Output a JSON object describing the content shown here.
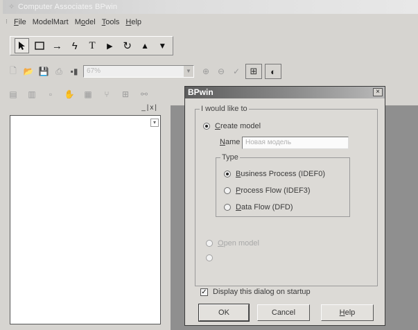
{
  "window": {
    "title": "Computer Associates BPwin"
  },
  "menubar": {
    "items": [
      {
        "pre": "",
        "u": "F",
        "post": "ile"
      },
      {
        "pre": "",
        "u": "",
        "post": "ModelMart"
      },
      {
        "pre": "M",
        "u": "o",
        "post": "del"
      },
      {
        "pre": "",
        "u": "T",
        "post": "ools"
      },
      {
        "pre": "",
        "u": "H",
        "post": "elp"
      }
    ]
  },
  "palette": {
    "icons": [
      "pointer-icon",
      "box-icon",
      "arrow-icon",
      "squiggle-icon",
      "text-icon",
      "triangle-right-icon",
      "undo-arrow-icon",
      "triangle-up-icon",
      "triangle-down-icon"
    ]
  },
  "std_toolbar": {
    "zoom_value": "67%"
  },
  "dialog": {
    "title": "BPwin",
    "intro_label": "I would like to",
    "create_model": {
      "u": "C",
      "rest": "reate model"
    },
    "name_label_u": "N",
    "name_label_rest": "ame",
    "name_value": "Новая модель",
    "type_label": "Type",
    "types": [
      {
        "u": "B",
        "rest": "usiness Process (IDEF0)",
        "selected": true
      },
      {
        "u": "P",
        "rest": "rocess Flow (IDEF3)",
        "selected": false
      },
      {
        "u": "D",
        "rest": "ata Flow (DFD)",
        "selected": false
      }
    ],
    "open_model": {
      "u": "O",
      "rest": "pen model"
    },
    "startup_checkbox": "Display this dialog on startup",
    "startup_checked": true,
    "buttons": {
      "ok": "OK",
      "cancel": "Cancel",
      "help_u": "H",
      "help_rest": "elp"
    }
  }
}
